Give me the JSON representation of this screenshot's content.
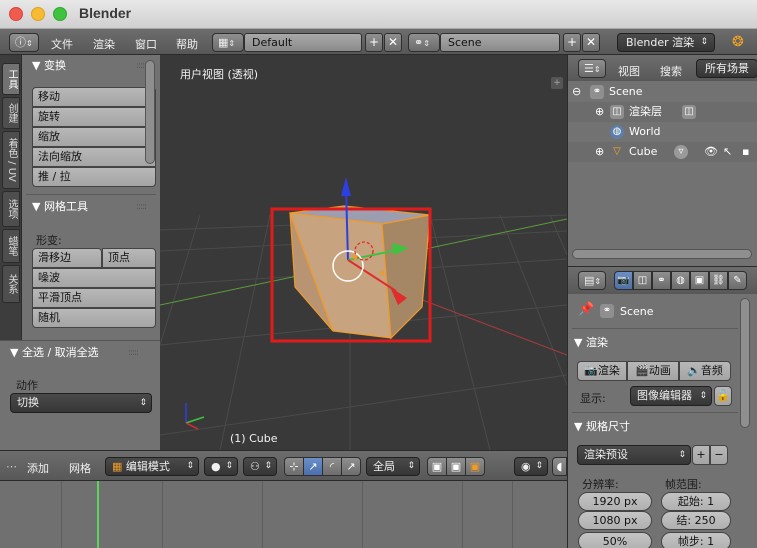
{
  "window": {
    "title": "Blender"
  },
  "info_header": {
    "menus": [
      "文件",
      "渲染",
      "窗口",
      "帮助"
    ],
    "screen_layout": "Default",
    "scene": "Scene",
    "render_engine": "Blender 渲染"
  },
  "left_tabs": [
    "工具",
    "创建",
    "着色 / UV",
    "选项",
    "蜡笔",
    "关系"
  ],
  "tool_shelf": {
    "transform": {
      "title": "变换",
      "buttons": [
        "移动",
        "旋转",
        "缩放",
        "法向缩放",
        "推 / 拉"
      ]
    },
    "mesh_tools": {
      "title": "网格工具",
      "deform_label": "形变:",
      "slide_edge": "滑移边",
      "vertex": "顶点",
      "noise": "噪波",
      "smooth_vertex": "平滑顶点",
      "random": "随机"
    }
  },
  "operator_panel": {
    "title": "全选 / 取消全选",
    "action_label": "动作",
    "action_value": "切换"
  },
  "viewport": {
    "title": "用户视图 (透视)",
    "status": "(1) Cube"
  },
  "view3d_header": {
    "menus": [
      "添加",
      "网格"
    ],
    "mode": "编辑模式",
    "pivot": "全局"
  },
  "outliner": {
    "header": {
      "view": "视图",
      "search": "搜索",
      "filter": "所有场景"
    },
    "items": [
      {
        "label": "Scene"
      },
      {
        "label": "渲染层"
      },
      {
        "label": "World"
      },
      {
        "label": "Cube"
      }
    ]
  },
  "properties": {
    "context": "Scene",
    "render_panel": {
      "title": "渲染",
      "render_btn": "渲染",
      "anim_btn": "动画",
      "audio_btn": "音频",
      "display_label": "显示:",
      "display_value": "图像编辑器"
    },
    "dimensions_panel": {
      "title": "规格尺寸",
      "preset": "渲染预设",
      "resolution_label": "分辨率:",
      "frame_range_label": "帧范围:",
      "res_x": "1920 px",
      "res_y": "1080 px",
      "res_pct": "50%",
      "start": "起始:  1",
      "end": "结: 250",
      "step": "帧步: 1"
    }
  },
  "colors": {
    "selection_box": "#e11b1b",
    "cube_face": "#c8a37f",
    "cube_edge": "#f09a2a",
    "axis_x": "#e02c2c",
    "axis_y": "#3fc23f",
    "axis_z": "#2d3fe0",
    "grid_green": "#5a9e3a",
    "grid_red": "#a83b3b"
  }
}
